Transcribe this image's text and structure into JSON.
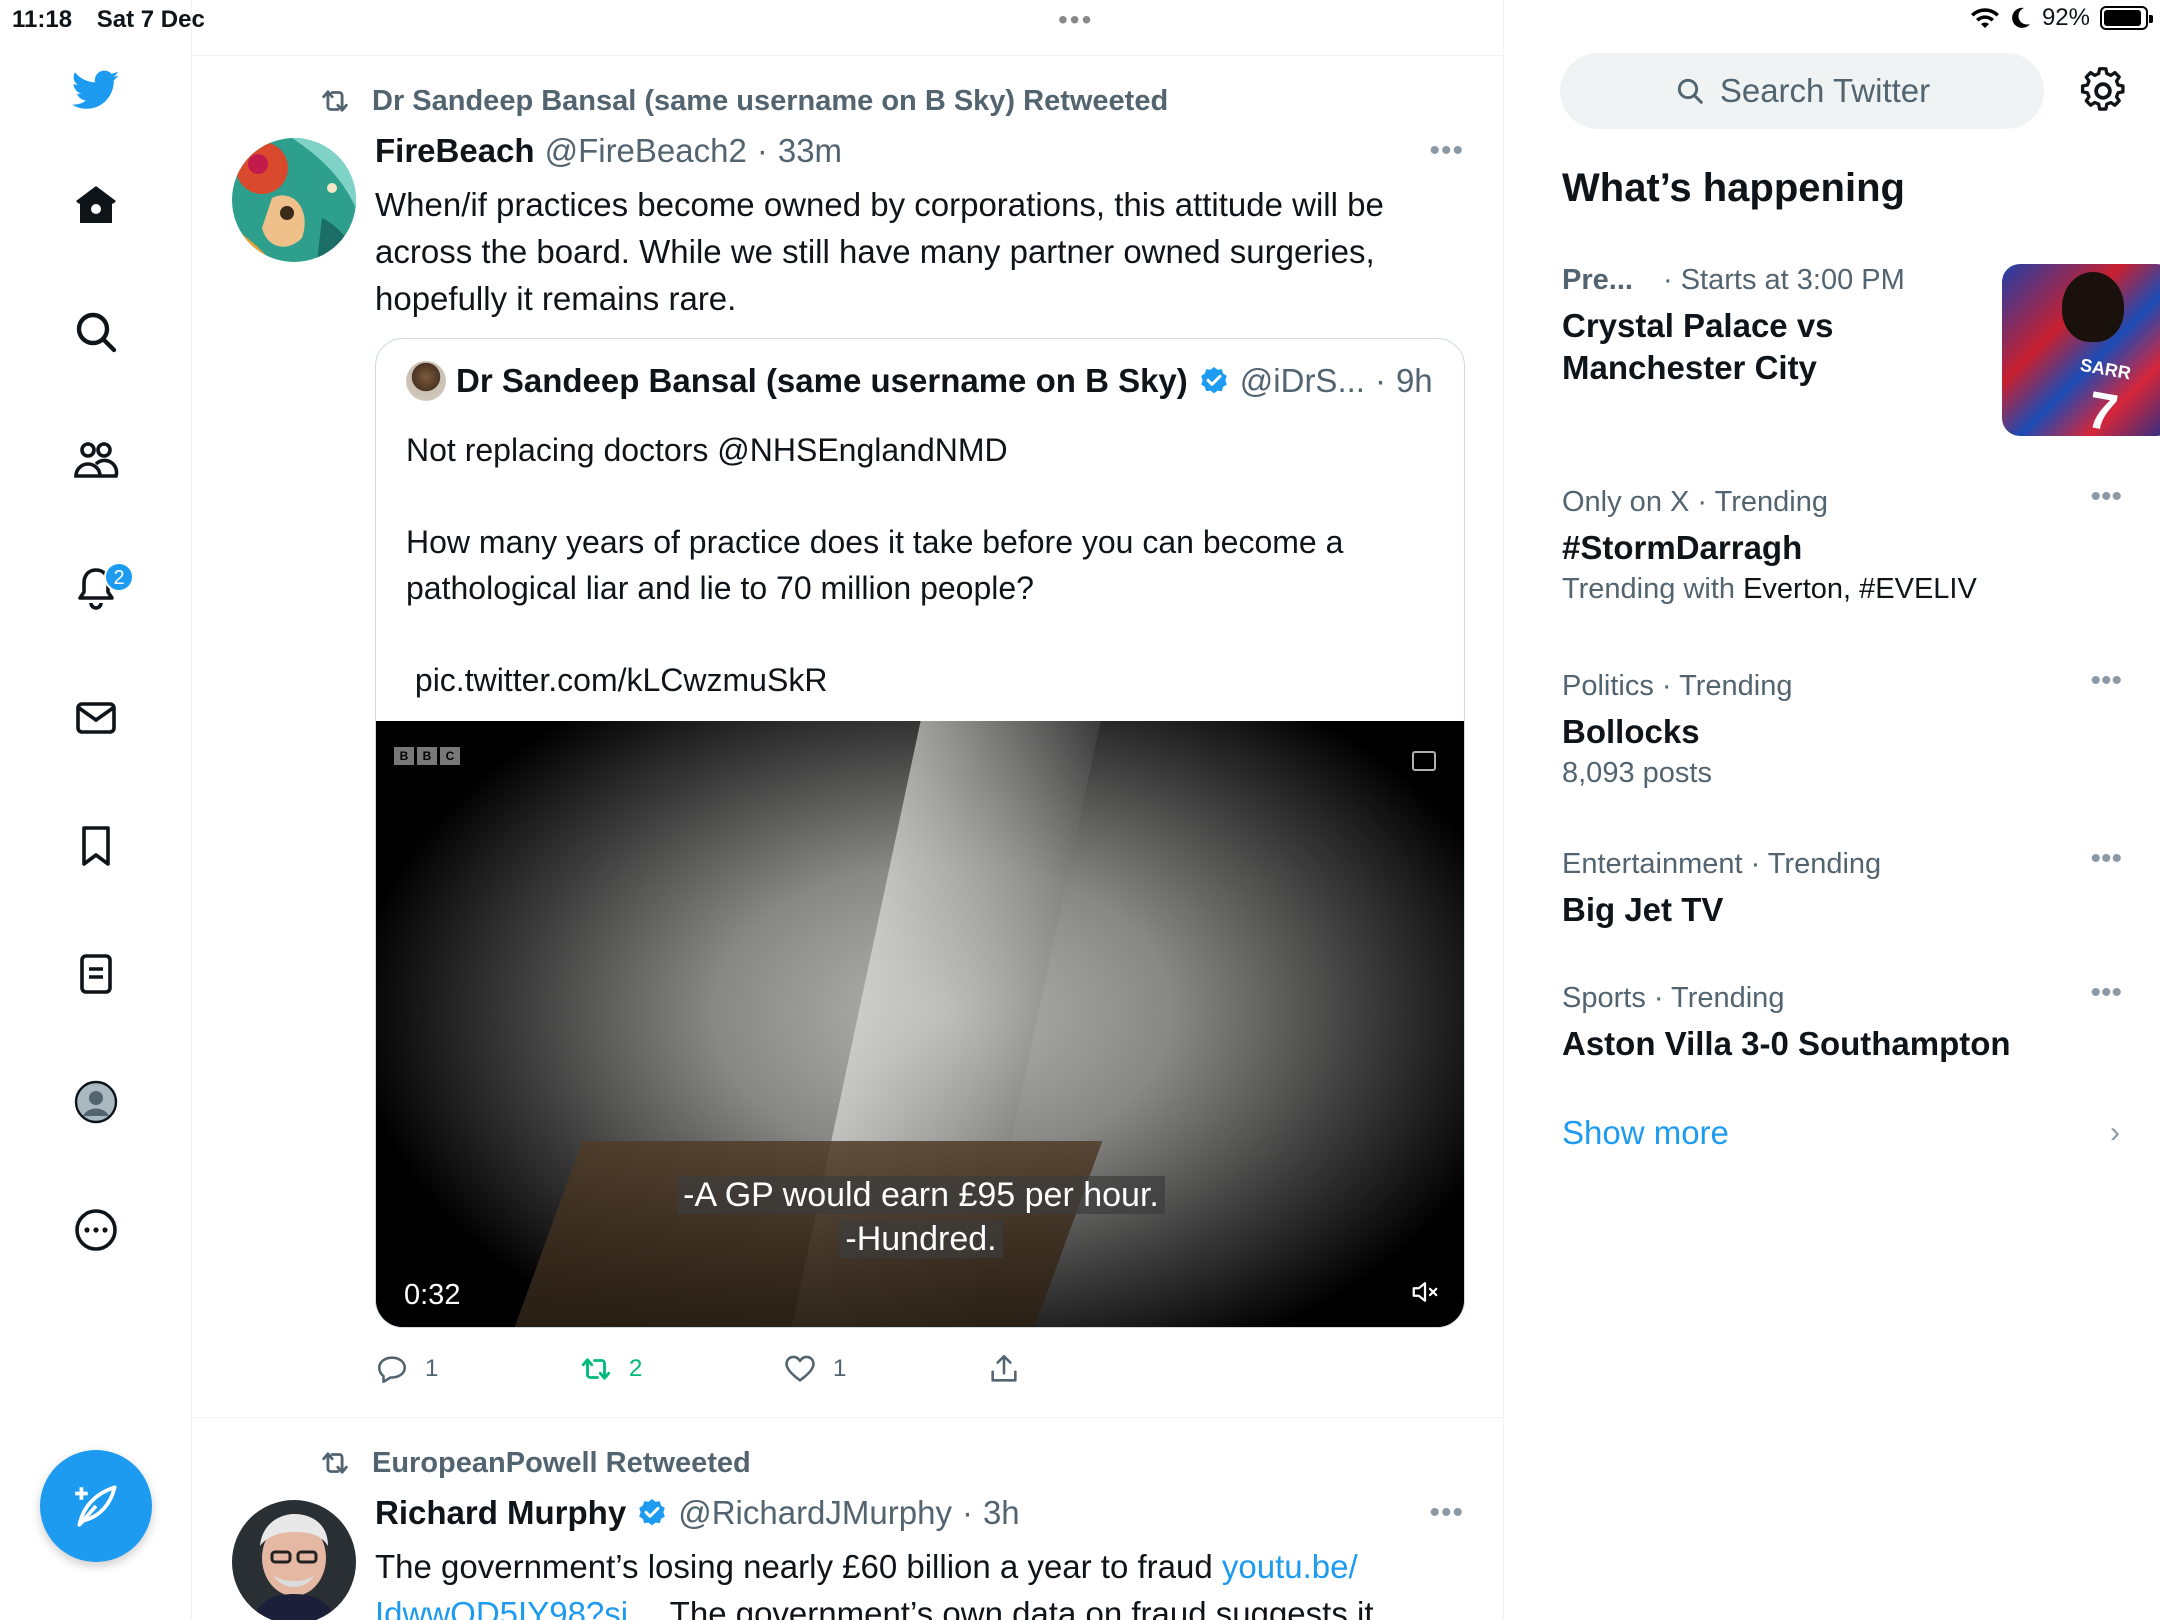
{
  "status_bar": {
    "time": "11:18",
    "date": "Sat 7 Dec",
    "battery": "92%",
    "battery_level": 0.92
  },
  "nav": {
    "notifications_badge": "2"
  },
  "tweets": [
    {
      "retweeted_by": "Dr Sandeep Bansal (same username on B Sky) Retweeted",
      "name": "FireBeach",
      "handle": "@FireBeach2",
      "sep": "·",
      "time": "33m",
      "text": "When/if practices become owned by corporations, this attitude will be across the board. While we still have many partner owned surgeries, hopefully it remains rare.",
      "quote": {
        "name": "Dr Sandeep Bansal (same username on B Sky)",
        "handle": "@iDrS...",
        "sep": "·",
        "time": "9h",
        "line1": "Not replacing doctors @NHSEnglandNMD",
        "line2": "How many years of practice does it take before you can become a pathological liar and lie to 70 million people?",
        "link": " pic.twitter.com/kLCwzmuSkR",
        "video": {
          "logo": [
            "B",
            "B",
            "C"
          ],
          "subtitle1": "-A GP would earn £95 per hour.",
          "subtitle2": "-Hundred.",
          "duration": "0:32"
        }
      },
      "actions": {
        "replies": "1",
        "retweets": "2",
        "likes": "1"
      }
    },
    {
      "retweeted_by": "EuropeanPowell Retweeted",
      "name": "Richard Murphy",
      "handle": "@RichardJMurphy",
      "sep": "·",
      "time": "3h",
      "text_start": "The government’s losing nearly £60 billion a year to fraud ",
      "link": "youtu.be/ IdwwQD5IY98?si…",
      "text_end": " The government’s own data on fraud suggests it"
    }
  ],
  "sidebar": {
    "search_placeholder": "Search Twitter",
    "section_title": "What’s happening",
    "trends": [
      {
        "meta": "Pre...",
        "meta2": "· Starts at 3:00 PM",
        "title": "Crystal Palace vs Manchester City",
        "image_text": "SARR",
        "image_number": "7"
      },
      {
        "meta": "Only on X · Trending",
        "title": "#StormDarragh",
        "sub_prefix": "Trending with ",
        "sub_with": "Everton, #EVELIV"
      },
      {
        "meta": "Politics · Trending",
        "title": "Bollocks",
        "sub": "8,093 posts"
      },
      {
        "meta": "Entertainment · Trending",
        "title": "Big Jet TV"
      },
      {
        "meta": "Sports · Trending",
        "title": "Aston Villa 3-0 Southampton"
      }
    ],
    "show_more": "Show more"
  },
  "colors": {
    "accent": "#1d9bf0",
    "retweet_green": "#00ba7c",
    "secondary_text": "#536471",
    "border": "#eff3f4"
  },
  "icons": [
    "twitter-bird-icon",
    "home-icon",
    "search-icon",
    "communities-icon",
    "bell-icon",
    "mail-icon",
    "bookmark-icon",
    "lists-icon",
    "profile-icon",
    "more-icon",
    "compose-icon",
    "retweet-icon",
    "reply-icon",
    "like-icon",
    "share-icon",
    "verified-icon",
    "gear-icon",
    "mute-icon",
    "captions-icon"
  ]
}
